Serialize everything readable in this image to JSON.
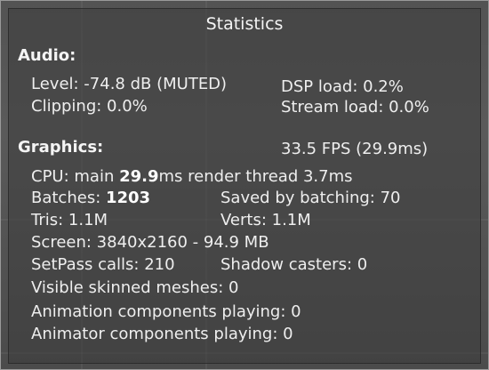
{
  "window": {
    "title": "Statistics"
  },
  "audio": {
    "heading": "Audio:",
    "level": "Level: -74.8 dB (MUTED)",
    "clipping": "Clipping: 0.0%",
    "dsp_load": "DSP load: 0.2%",
    "stream_load": "Stream load: 0.0%"
  },
  "graphics": {
    "heading": "Graphics:",
    "fps": "33.5 FPS (29.9ms)",
    "cpu_prefix": "CPU: main ",
    "cpu_main_value": "29.9",
    "cpu_suffix": "ms  render thread 3.7ms",
    "batches_prefix": "Batches: ",
    "batches_value": "1203",
    "saved_by_batching": "Saved by batching: 70",
    "tris": "Tris: 1.1M",
    "verts": "Verts: 1.1M",
    "screen": "Screen: 3840x2160 - 94.9 MB",
    "setpass": "SetPass calls: 210",
    "shadow_casters": "Shadow casters: 0",
    "skinned_meshes": "Visible skinned meshes: 0",
    "animation_components": "Animation components playing: 0",
    "animator_components": "Animator components playing: 0"
  }
}
